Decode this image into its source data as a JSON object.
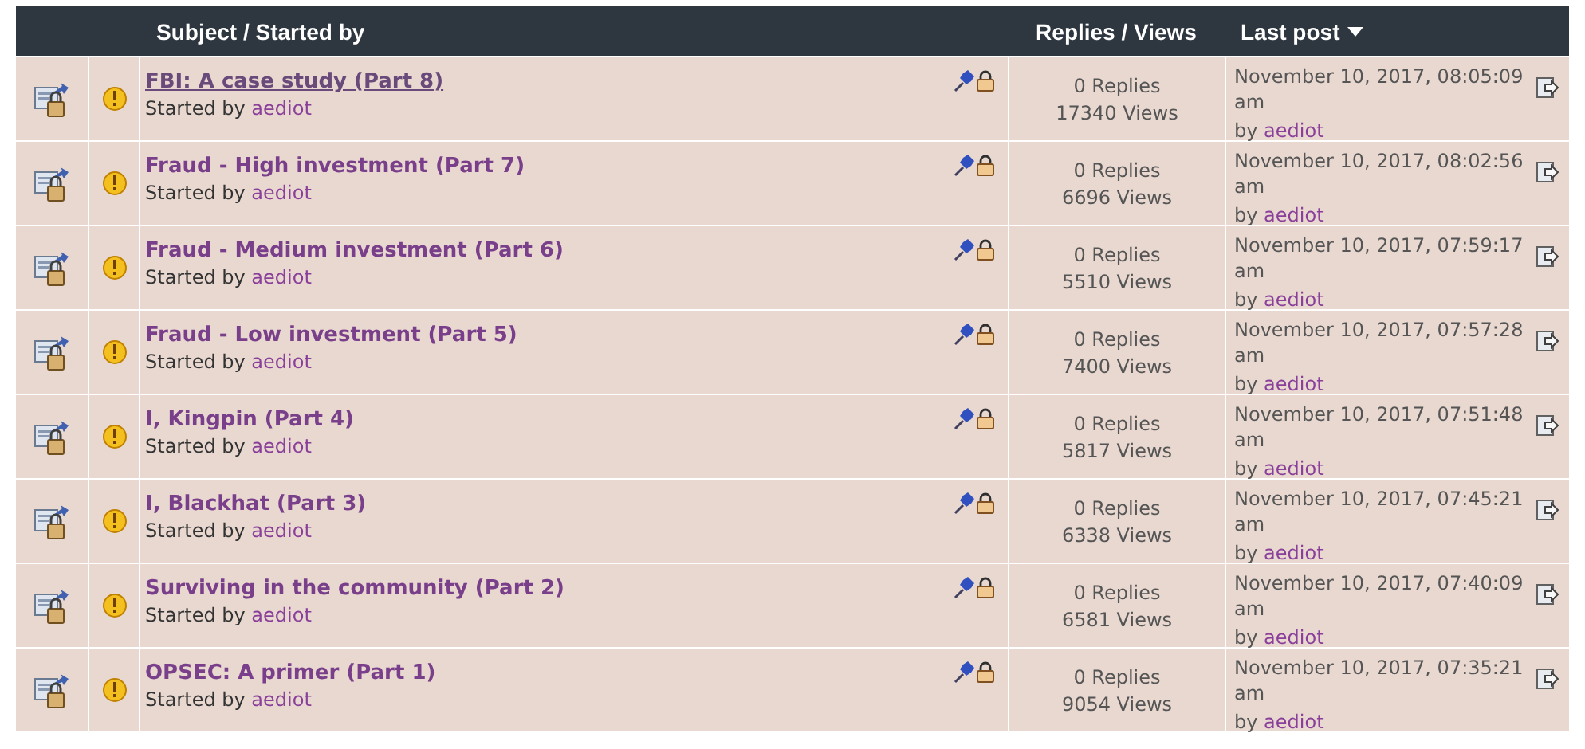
{
  "header": {
    "subject": "Subject / Started by",
    "stats": "Replies / Views",
    "last_post": "Last post",
    "sort_descending": true
  },
  "topics": [
    {
      "title": "FBI: A case study (Part 8)",
      "hovered": true,
      "started_prefix": "Started by",
      "author": "aediot",
      "sticky": true,
      "locked": true,
      "replies": "0 Replies",
      "views": "17340 Views",
      "time": "November 10, 2017, 08:05:09 am",
      "by": "by",
      "last_author": "aediot"
    },
    {
      "title": "Fraud - High investment (Part 7)",
      "hovered": false,
      "started_prefix": "Started by",
      "author": "aediot",
      "sticky": true,
      "locked": true,
      "replies": "0 Replies",
      "views": "6696 Views",
      "time": "November 10, 2017, 08:02:56 am",
      "by": "by",
      "last_author": "aediot"
    },
    {
      "title": "Fraud - Medium investment (Part 6)",
      "hovered": false,
      "started_prefix": "Started by",
      "author": "aediot",
      "sticky": true,
      "locked": true,
      "replies": "0 Replies",
      "views": "5510 Views",
      "time": "November 10, 2017, 07:59:17 am",
      "by": "by",
      "last_author": "aediot"
    },
    {
      "title": "Fraud - Low investment (Part 5)",
      "hovered": false,
      "started_prefix": "Started by",
      "author": "aediot",
      "sticky": true,
      "locked": true,
      "replies": "0 Replies",
      "views": "7400 Views",
      "time": "November 10, 2017, 07:57:28 am",
      "by": "by",
      "last_author": "aediot"
    },
    {
      "title": "I, Kingpin (Part 4)",
      "hovered": false,
      "started_prefix": "Started by",
      "author": "aediot",
      "sticky": true,
      "locked": true,
      "replies": "0 Replies",
      "views": "5817 Views",
      "time": "November 10, 2017, 07:51:48 am",
      "by": "by",
      "last_author": "aediot"
    },
    {
      "title": "I, Blackhat (Part 3)",
      "hovered": false,
      "started_prefix": "Started by",
      "author": "aediot",
      "sticky": true,
      "locked": true,
      "replies": "0 Replies",
      "views": "6338 Views",
      "time": "November 10, 2017, 07:45:21 am",
      "by": "by",
      "last_author": "aediot"
    },
    {
      "title": "Surviving in the community (Part 2)",
      "hovered": false,
      "started_prefix": "Started by",
      "author": "aediot",
      "sticky": true,
      "locked": true,
      "replies": "0 Replies",
      "views": "6581 Views",
      "time": "November 10, 2017, 07:40:09 am",
      "by": "by",
      "last_author": "aediot"
    },
    {
      "title": "OPSEC: A primer (Part 1)",
      "hovered": false,
      "started_prefix": "Started by",
      "author": "aediot",
      "sticky": true,
      "locked": true,
      "replies": "0 Replies",
      "views": "9054 Views",
      "time": "November 10, 2017, 07:35:21 am",
      "by": "by",
      "last_author": "aediot"
    }
  ]
}
